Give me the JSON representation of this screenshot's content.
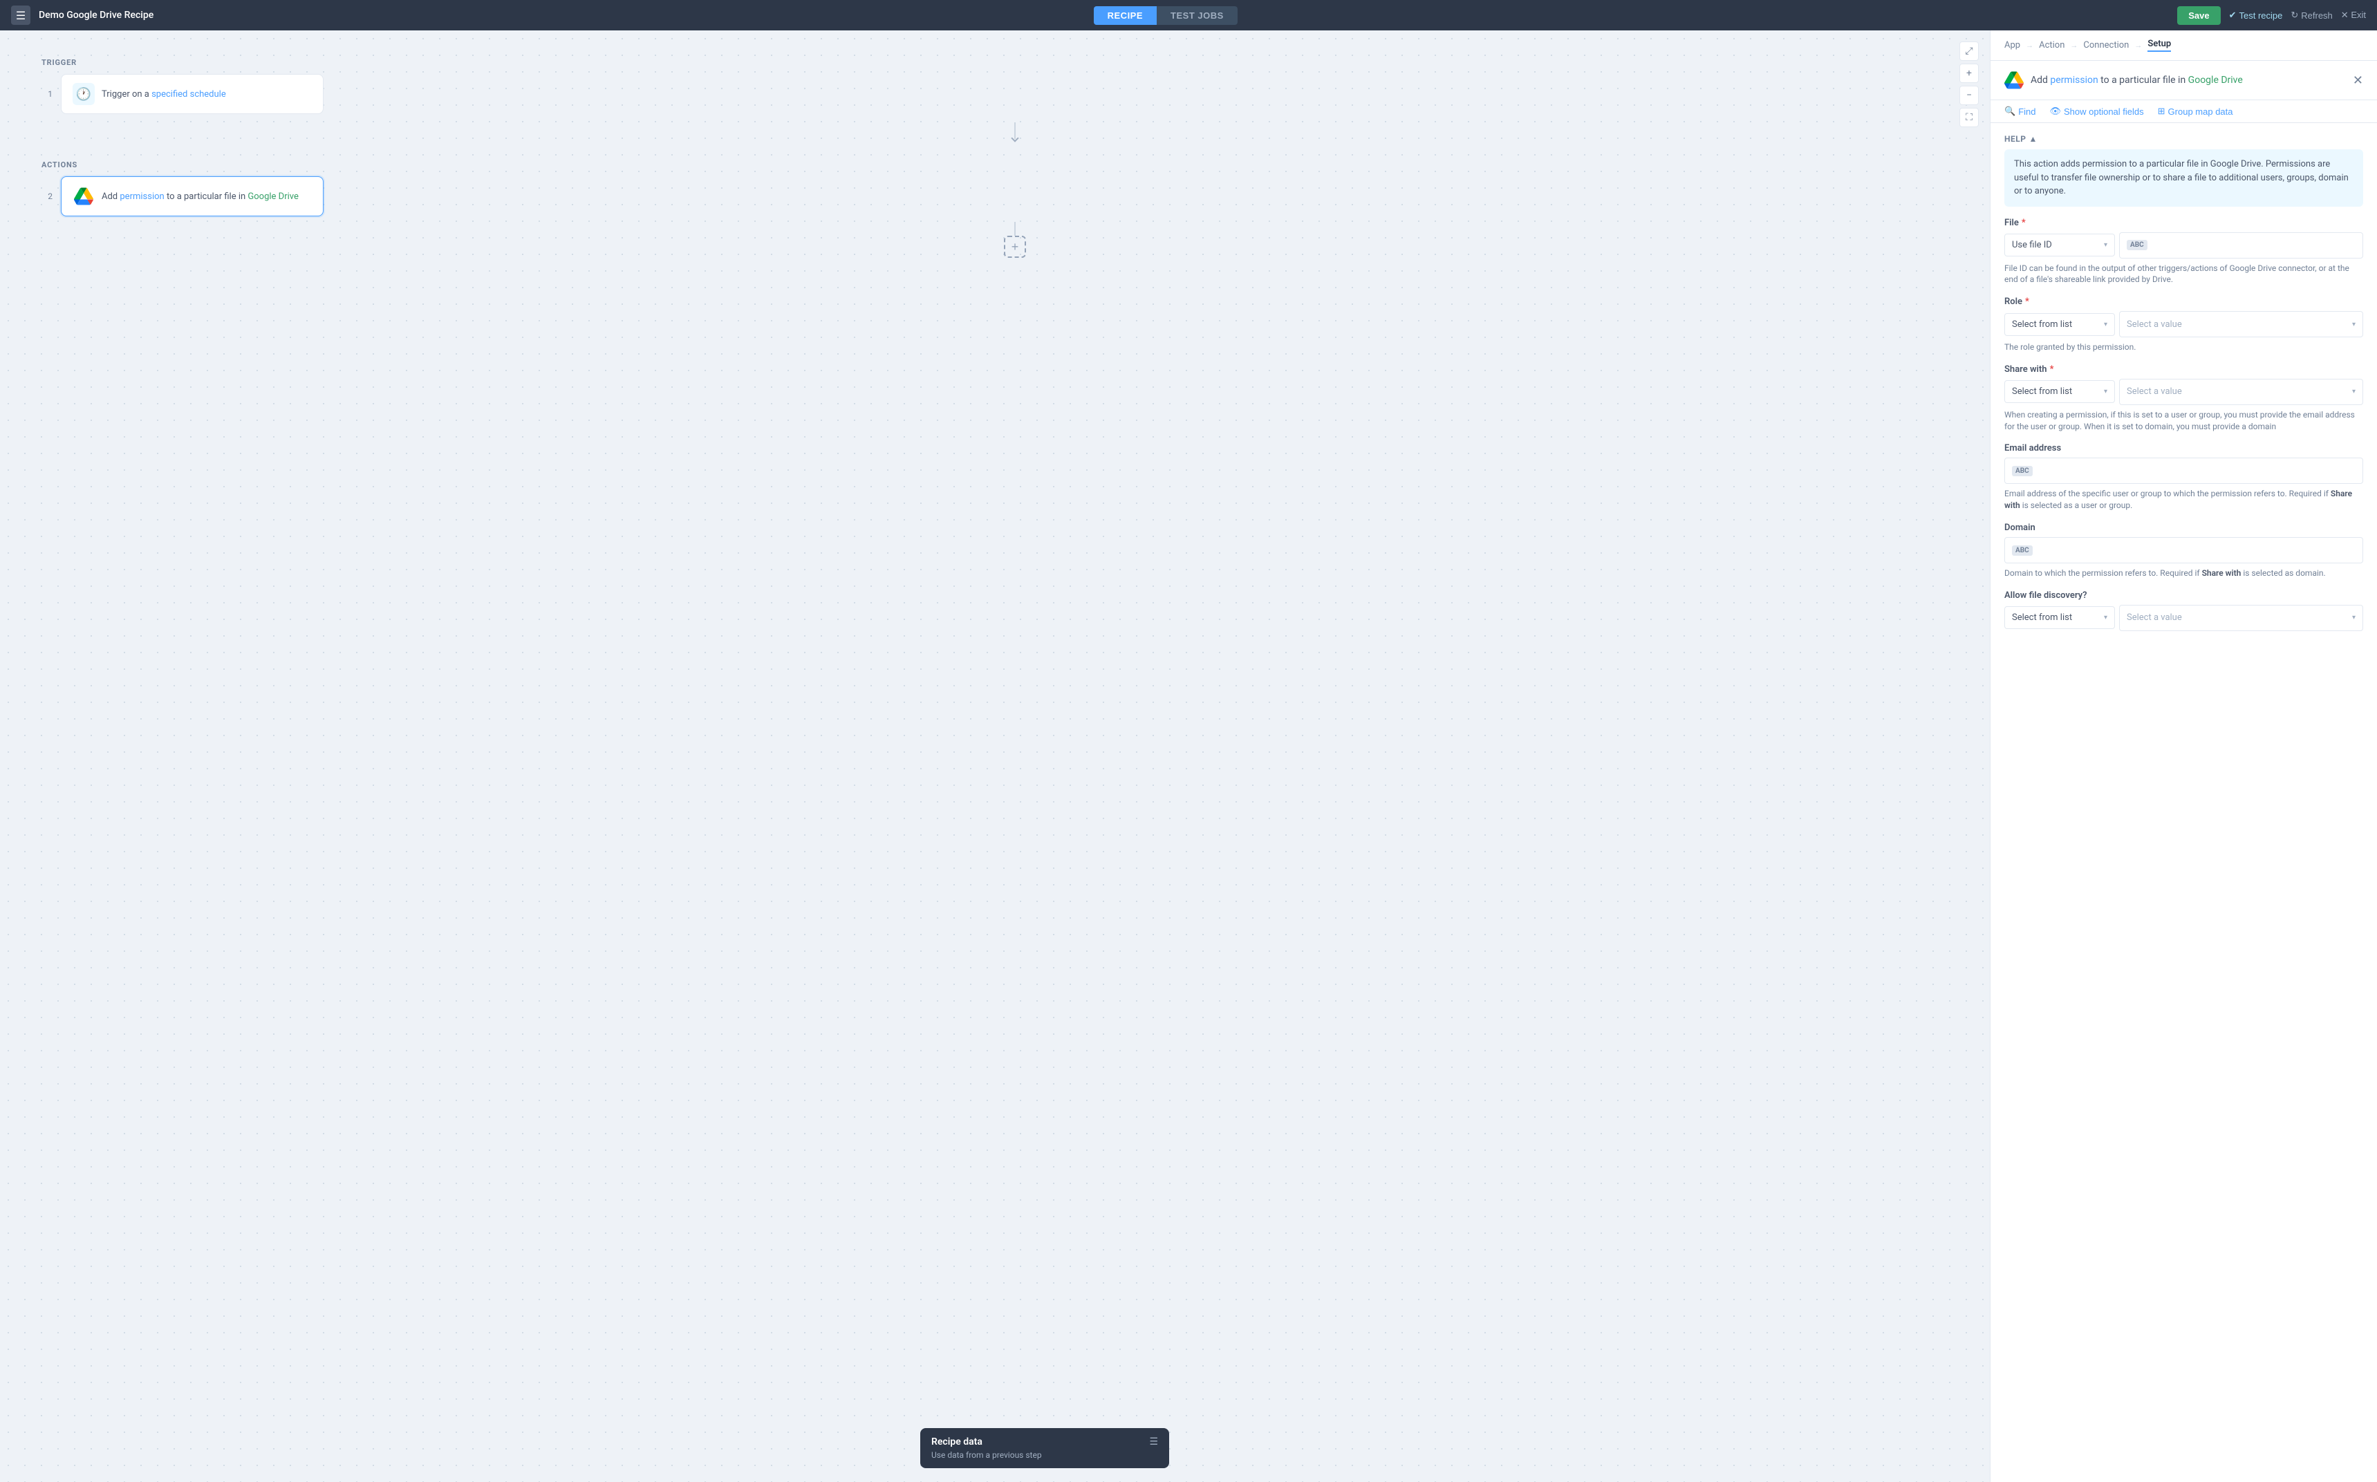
{
  "app": {
    "title": "Demo Google Drive Recipe"
  },
  "topNav": {
    "icon": "☰",
    "tabs": [
      {
        "id": "recipe",
        "label": "RECIPE",
        "active": true
      },
      {
        "id": "testjobs",
        "label": "TEST JOBS",
        "active": false
      }
    ],
    "buttons": {
      "save": "Save",
      "testRecipe": "Test recipe",
      "refresh": "Refresh",
      "exit": "Exit"
    }
  },
  "canvas": {
    "trigger": {
      "sectionLabel": "TRIGGER",
      "step": {
        "num": "1",
        "icon": "🕐",
        "text": "Trigger on a specified schedule",
        "linkText": "specified schedule"
      }
    },
    "actions": {
      "sectionLabel": "ACTIONS",
      "step": {
        "num": "2",
        "text": "Add permission to a particular file in Google Drive",
        "linkPermission": "permission",
        "linkDrive": "Google Drive",
        "active": true
      }
    },
    "addStepLabel": "+"
  },
  "recipeDataPanel": {
    "title": "Recipe data",
    "subtitle": "Use data from a previous step"
  },
  "rightPanel": {
    "breadcrumb": {
      "items": [
        "App",
        "Action",
        "Connection",
        "Setup"
      ],
      "active": "Setup"
    },
    "header": {
      "prefix": "Add",
      "linkPermission": "permission",
      "middle": "to a particular file in",
      "linkDrive": "Google Drive"
    },
    "toolbar": {
      "find": "Find",
      "showOptionalFields": "Show optional fields",
      "groupMapData": "Group map data"
    },
    "help": {
      "toggleLabel": "HELP",
      "text": "This action adds permission to a particular file in Google Drive. Permissions are useful to transfer file ownership or to share a file to additional users, groups, domain or to anyone."
    },
    "fields": {
      "file": {
        "label": "File",
        "required": true,
        "dropdownLabel": "Use file ID",
        "hint": "File ID can be found in the output of other triggers/actions of Google Drive connector, or at the end of a file's shareable link provided by Drive."
      },
      "role": {
        "label": "Role",
        "required": true,
        "dropdownLabel": "Select from list",
        "valuePlaceholder": "Select a value",
        "hint": "The role granted by this permission."
      },
      "shareWith": {
        "label": "Share with",
        "required": true,
        "dropdownLabel": "Select from list",
        "valuePlaceholder": "Select a value",
        "hint": "When creating a permission, if this is set to a user or group, you must provide the email address for the user or group. When it is set to domain, you must provide a domain"
      },
      "emailAddress": {
        "label": "Email address",
        "required": false,
        "hint": "Email address of the specific user or group to which the permission refers to. Required if Share with is selected as a user or group.",
        "hintBold": "Share with"
      },
      "domain": {
        "label": "Domain",
        "required": false,
        "hint": "Domain to which the permission refers to. Required if Share with is selected as domain.",
        "hintBold": "Share with"
      },
      "allowFileDiscovery": {
        "label": "Allow file discovery?",
        "required": false,
        "dropdownLabel": "Select from list",
        "valuePlaceholder": "Select a value"
      }
    }
  }
}
